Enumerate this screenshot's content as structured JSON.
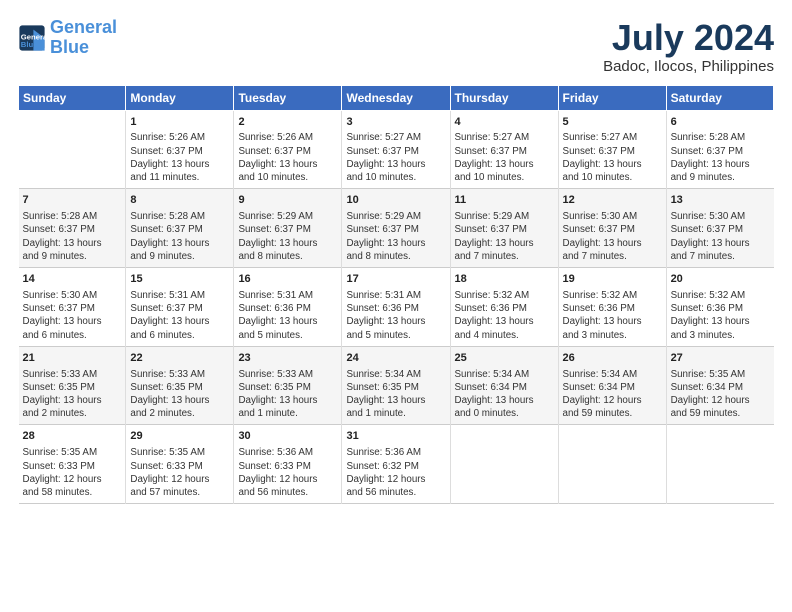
{
  "header": {
    "logo_line1": "General",
    "logo_line2": "Blue",
    "title": "July 2024",
    "subtitle": "Badoc, Ilocos, Philippines"
  },
  "columns": [
    "Sunday",
    "Monday",
    "Tuesday",
    "Wednesday",
    "Thursday",
    "Friday",
    "Saturday"
  ],
  "weeks": [
    [
      {
        "day": "",
        "text": ""
      },
      {
        "day": "1",
        "text": "Sunrise: 5:26 AM\nSunset: 6:37 PM\nDaylight: 13 hours\nand 11 minutes."
      },
      {
        "day": "2",
        "text": "Sunrise: 5:26 AM\nSunset: 6:37 PM\nDaylight: 13 hours\nand 10 minutes."
      },
      {
        "day": "3",
        "text": "Sunrise: 5:27 AM\nSunset: 6:37 PM\nDaylight: 13 hours\nand 10 minutes."
      },
      {
        "day": "4",
        "text": "Sunrise: 5:27 AM\nSunset: 6:37 PM\nDaylight: 13 hours\nand 10 minutes."
      },
      {
        "day": "5",
        "text": "Sunrise: 5:27 AM\nSunset: 6:37 PM\nDaylight: 13 hours\nand 10 minutes."
      },
      {
        "day": "6",
        "text": "Sunrise: 5:28 AM\nSunset: 6:37 PM\nDaylight: 13 hours\nand 9 minutes."
      }
    ],
    [
      {
        "day": "7",
        "text": "Sunrise: 5:28 AM\nSunset: 6:37 PM\nDaylight: 13 hours\nand 9 minutes."
      },
      {
        "day": "8",
        "text": "Sunrise: 5:28 AM\nSunset: 6:37 PM\nDaylight: 13 hours\nand 9 minutes."
      },
      {
        "day": "9",
        "text": "Sunrise: 5:29 AM\nSunset: 6:37 PM\nDaylight: 13 hours\nand 8 minutes."
      },
      {
        "day": "10",
        "text": "Sunrise: 5:29 AM\nSunset: 6:37 PM\nDaylight: 13 hours\nand 8 minutes."
      },
      {
        "day": "11",
        "text": "Sunrise: 5:29 AM\nSunset: 6:37 PM\nDaylight: 13 hours\nand 7 minutes."
      },
      {
        "day": "12",
        "text": "Sunrise: 5:30 AM\nSunset: 6:37 PM\nDaylight: 13 hours\nand 7 minutes."
      },
      {
        "day": "13",
        "text": "Sunrise: 5:30 AM\nSunset: 6:37 PM\nDaylight: 13 hours\nand 7 minutes."
      }
    ],
    [
      {
        "day": "14",
        "text": "Sunrise: 5:30 AM\nSunset: 6:37 PM\nDaylight: 13 hours\nand 6 minutes."
      },
      {
        "day": "15",
        "text": "Sunrise: 5:31 AM\nSunset: 6:37 PM\nDaylight: 13 hours\nand 6 minutes."
      },
      {
        "day": "16",
        "text": "Sunrise: 5:31 AM\nSunset: 6:36 PM\nDaylight: 13 hours\nand 5 minutes."
      },
      {
        "day": "17",
        "text": "Sunrise: 5:31 AM\nSunset: 6:36 PM\nDaylight: 13 hours\nand 5 minutes."
      },
      {
        "day": "18",
        "text": "Sunrise: 5:32 AM\nSunset: 6:36 PM\nDaylight: 13 hours\nand 4 minutes."
      },
      {
        "day": "19",
        "text": "Sunrise: 5:32 AM\nSunset: 6:36 PM\nDaylight: 13 hours\nand 3 minutes."
      },
      {
        "day": "20",
        "text": "Sunrise: 5:32 AM\nSunset: 6:36 PM\nDaylight: 13 hours\nand 3 minutes."
      }
    ],
    [
      {
        "day": "21",
        "text": "Sunrise: 5:33 AM\nSunset: 6:35 PM\nDaylight: 13 hours\nand 2 minutes."
      },
      {
        "day": "22",
        "text": "Sunrise: 5:33 AM\nSunset: 6:35 PM\nDaylight: 13 hours\nand 2 minutes."
      },
      {
        "day": "23",
        "text": "Sunrise: 5:33 AM\nSunset: 6:35 PM\nDaylight: 13 hours\nand 1 minute."
      },
      {
        "day": "24",
        "text": "Sunrise: 5:34 AM\nSunset: 6:35 PM\nDaylight: 13 hours\nand 1 minute."
      },
      {
        "day": "25",
        "text": "Sunrise: 5:34 AM\nSunset: 6:34 PM\nDaylight: 13 hours\nand 0 minutes."
      },
      {
        "day": "26",
        "text": "Sunrise: 5:34 AM\nSunset: 6:34 PM\nDaylight: 12 hours\nand 59 minutes."
      },
      {
        "day": "27",
        "text": "Sunrise: 5:35 AM\nSunset: 6:34 PM\nDaylight: 12 hours\nand 59 minutes."
      }
    ],
    [
      {
        "day": "28",
        "text": "Sunrise: 5:35 AM\nSunset: 6:33 PM\nDaylight: 12 hours\nand 58 minutes."
      },
      {
        "day": "29",
        "text": "Sunrise: 5:35 AM\nSunset: 6:33 PM\nDaylight: 12 hours\nand 57 minutes."
      },
      {
        "day": "30",
        "text": "Sunrise: 5:36 AM\nSunset: 6:33 PM\nDaylight: 12 hours\nand 56 minutes."
      },
      {
        "day": "31",
        "text": "Sunrise: 5:36 AM\nSunset: 6:32 PM\nDaylight: 12 hours\nand 56 minutes."
      },
      {
        "day": "",
        "text": ""
      },
      {
        "day": "",
        "text": ""
      },
      {
        "day": "",
        "text": ""
      }
    ]
  ]
}
